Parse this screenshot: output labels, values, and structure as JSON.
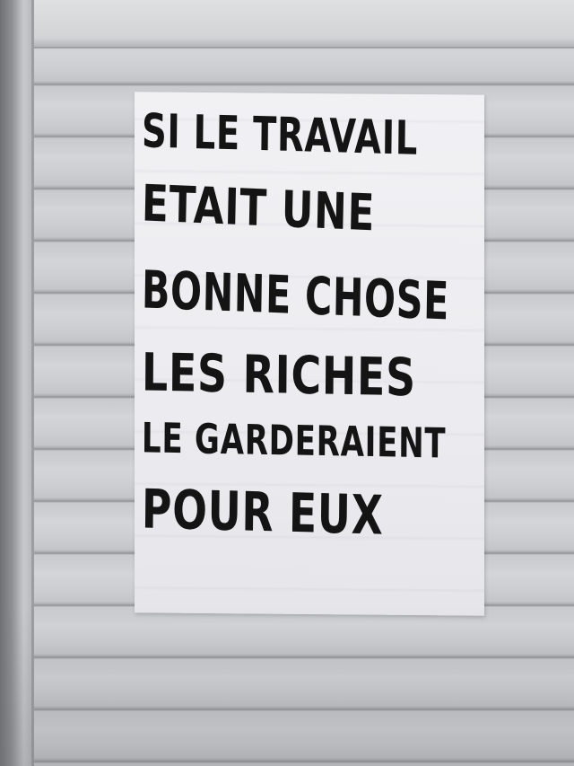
{
  "poster": {
    "lines": [
      "SI LE TRAVAIL",
      "ETAIT UNE",
      "BONNE CHOSE",
      "LES RICHES",
      "LE GARDERAIENT",
      "POUR EUX"
    ]
  }
}
